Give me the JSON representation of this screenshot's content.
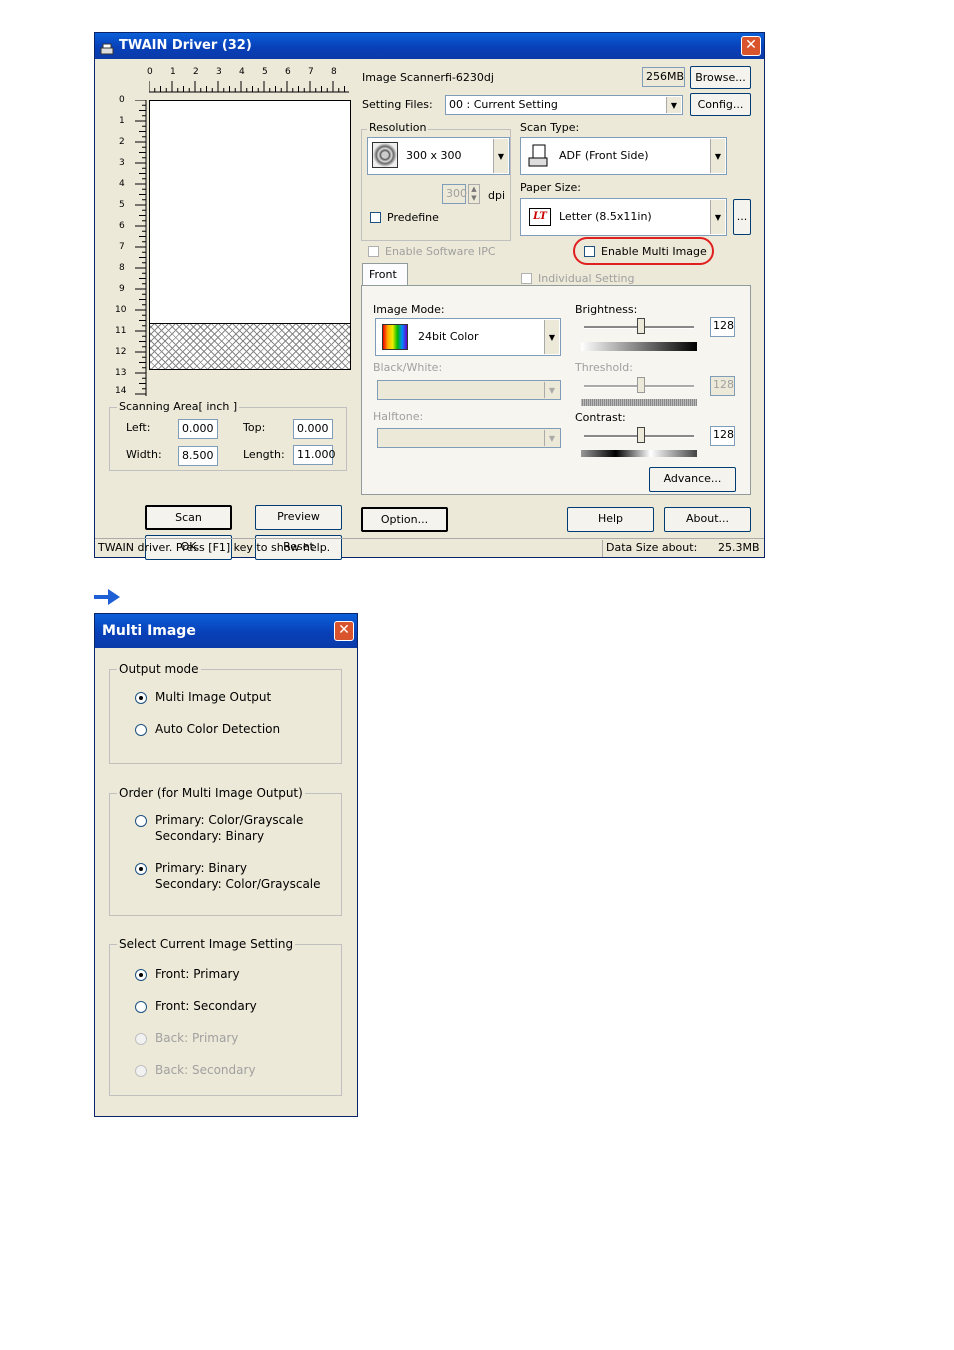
{
  "twain": {
    "title": "TWAIN Driver (32)",
    "ruler_top": [
      "0",
      "1",
      "2",
      "3",
      "4",
      "5",
      "6",
      "7",
      "8"
    ],
    "ruler_left": [
      "0",
      "1",
      "2",
      "3",
      "4",
      "5",
      "6",
      "7",
      "8",
      "9",
      "10",
      "11",
      "12",
      "13",
      "14"
    ],
    "scan_area": {
      "legend": "Scanning Area[ inch ]",
      "left_label": "Left:",
      "left_value": "0.000",
      "top_label": "Top:",
      "top_value": "0.000",
      "width_label": "Width:",
      "width_value": "8.500",
      "length_label": "Length:",
      "length_value": "11.000"
    },
    "buttons": {
      "scan": "Scan",
      "preview": "Preview",
      "ok": "OK",
      "reset": "Reset",
      "option": "Option...",
      "help": "Help",
      "about": "About...",
      "browse": "Browse...",
      "config": "Config...",
      "advance": "Advance...",
      "paper_more": "..."
    },
    "image_scanner_label": "Image Scanner:",
    "image_scanner_value": "fi-6230dj",
    "memory": "256MB",
    "setting_files_label": "Setting Files:",
    "setting_files_value": "00 : Current Setting",
    "resolution_label": "Resolution",
    "resolution_value": "300 x 300",
    "custom_dpi_value": "300",
    "dpi_label": "dpi",
    "predefine_label": "Predefine",
    "scan_type_label": "Scan Type:",
    "scan_type_value": "ADF (Front Side)",
    "paper_size_label": "Paper Size:",
    "paper_size_value": "Letter (8.5x11in)",
    "paper_icon_text": "LT",
    "enable_ipc_label": "Enable Software IPC",
    "enable_multi_label": "Enable Multi Image",
    "front_tab": "Front",
    "individual_setting_label": "Individual Setting",
    "image_mode_label": "Image Mode:",
    "image_mode_value": "24bit Color",
    "black_white_label": "Black/White:",
    "halftone_label": "Halftone:",
    "brightness_label": "Brightness:",
    "brightness_value": "128",
    "threshold_label": "Threshold:",
    "threshold_value": "128",
    "contrast_label": "Contrast:",
    "contrast_value": "128",
    "status_text": "TWAIN driver. Press [F1] key to show help.",
    "data_size_label": "Data Size about:",
    "data_size_value": "25.3MB",
    "highlight_color": "#e02020"
  },
  "multi": {
    "title": "Multi Image",
    "output_mode_legend": "Output mode",
    "multi_image_output": "Multi Image Output",
    "auto_color_detection": "Auto Color Detection",
    "order_legend": "Order (for Multi Image Output)",
    "order_opt1_line1": "Primary: Color/Grayscale",
    "order_opt1_line2": "Secondary: Binary",
    "order_opt2_line1": "Primary: Binary",
    "order_opt2_line2": "Secondary: Color/Grayscale",
    "select_legend": "Select Current Image Setting",
    "front_primary": "Front: Primary",
    "front_secondary": "Front: Secondary",
    "back_primary": "Back: Primary",
    "back_secondary": "Back: Secondary"
  },
  "arrow_color": "#1e5fd6"
}
